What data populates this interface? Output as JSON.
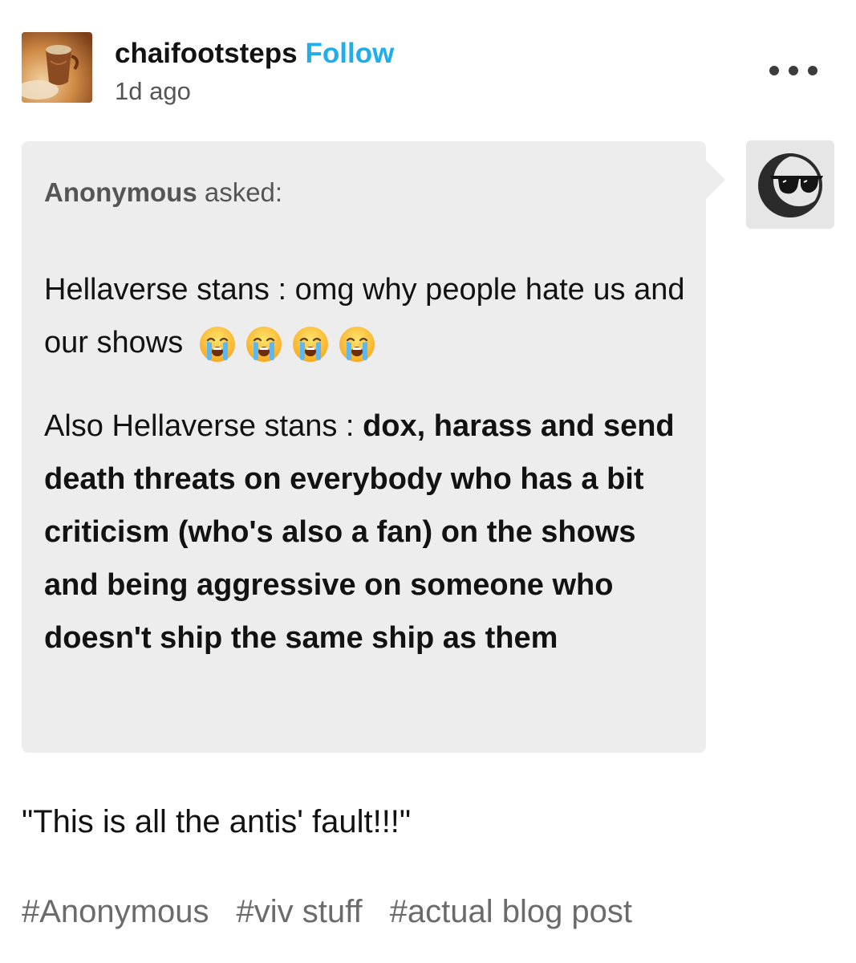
{
  "post": {
    "blog_name": "chaifootsteps",
    "follow_label": "Follow",
    "time_ago": "1d ago",
    "more_icon": "more-options-icon"
  },
  "ask": {
    "asker_name": "Anonymous",
    "asked_suffix": " asked:",
    "question_p1_text": "Hellaverse stans : omg why people hate us and our shows",
    "question_p1_emoji": "loudly-crying-face",
    "question_p1_emoji_count": 4,
    "question_p2_prefix": "Also Hellaverse stans : ",
    "question_p2_bold": "dox, harass and send death threats on everybody who has a bit criticism (who's also a fan) on the shows and being aggressive on someone who doesn't ship the same ship as them",
    "asker_avatar_icon": "anonymous-sunglasses-avatar-icon"
  },
  "reply": {
    "text": "\"This is all the antis' fault!!!\""
  },
  "tags": [
    "#Anonymous",
    "#viv stuff",
    "#actual blog post"
  ],
  "colors": {
    "follow": "#1faee9",
    "ask_background": "#ededed",
    "tag_text": "#6b6b6b",
    "meta_text": "#555555"
  }
}
